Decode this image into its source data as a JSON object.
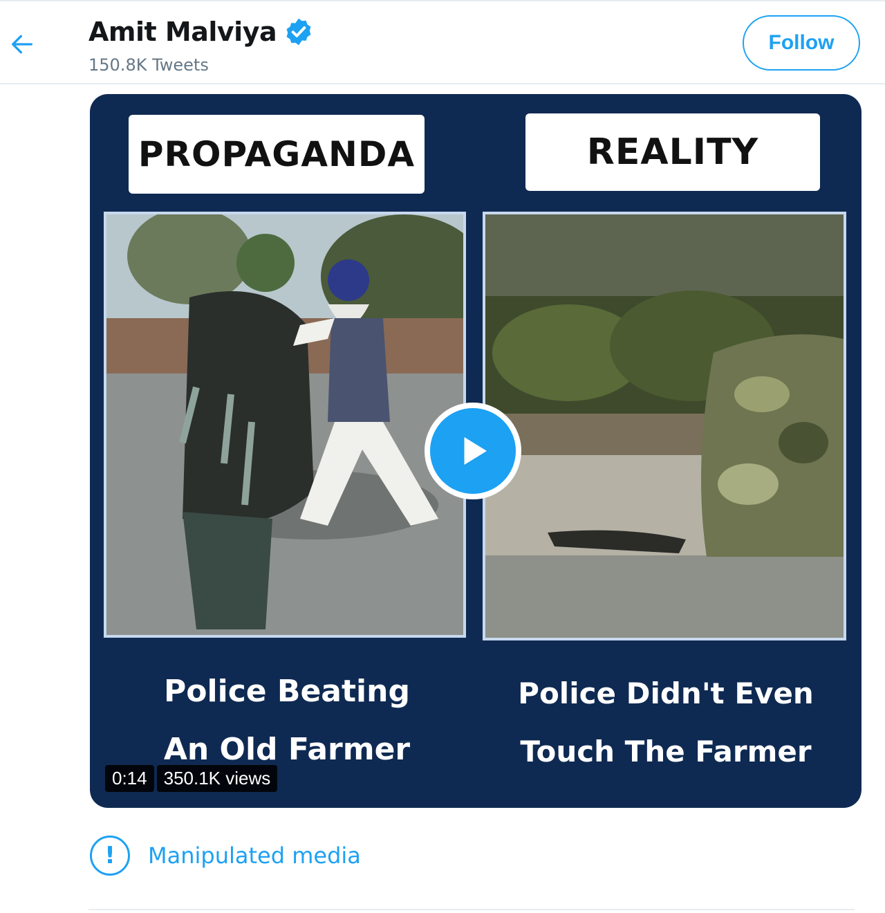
{
  "header": {
    "back_icon": "arrow-left-icon",
    "user_name": "Amit Malviya",
    "verified_icon": "verified-badge-icon",
    "tweet_count": "150.8K Tweets",
    "follow_label": "Follow"
  },
  "media": {
    "left_label": "PROPAGANDA",
    "right_label": "REALITY",
    "left_caption_line1": "Police Beating",
    "left_caption_line2": "An Old Farmer",
    "right_caption_line1": "Police Didn't Even",
    "right_caption_line2": "Touch The Farmer",
    "play_icon": "play-icon",
    "duration": "0:14",
    "views": "350.1K views"
  },
  "notice": {
    "icon": "exclamation-circle-icon",
    "text": "Manipulated media"
  },
  "colors": {
    "accent": "#1da1f2",
    "media_background": "#0f2a52"
  }
}
